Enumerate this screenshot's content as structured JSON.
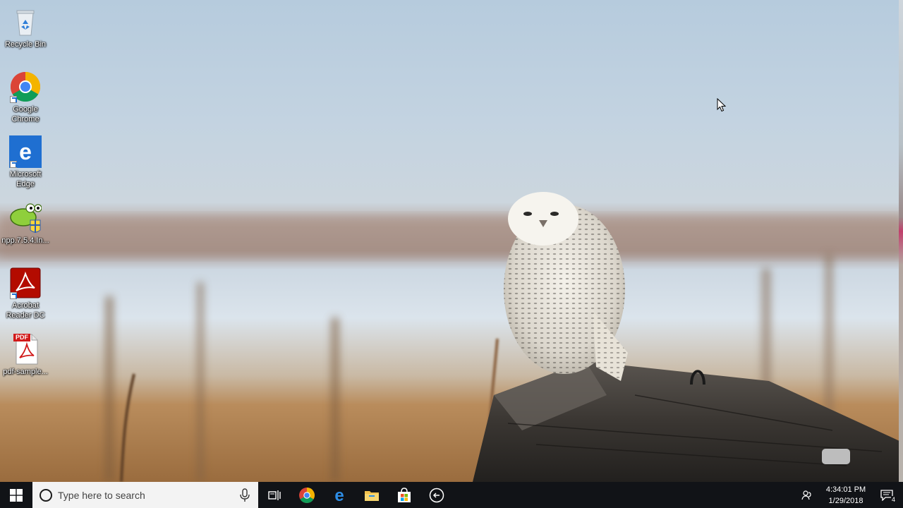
{
  "desktop": {
    "icons": [
      {
        "label": "Recycle Bin",
        "icon": "recycle-bin-icon"
      },
      {
        "label": "Google Chrome",
        "icon": "chrome-icon"
      },
      {
        "label": "Microsoft Edge",
        "icon": "edge-icon"
      },
      {
        "label": "npp.7.5.4.In...",
        "icon": "notepad-plus-plus-installer-icon"
      },
      {
        "label": "Acrobat Reader DC",
        "icon": "acrobat-reader-icon"
      },
      {
        "label": "pdf-sample...",
        "icon": "pdf-file-icon"
      }
    ],
    "pdf_badge": "PDF"
  },
  "taskbar": {
    "search_placeholder": "Type here to search",
    "pinned": [
      {
        "name": "task-view",
        "icon": "task-view-icon"
      },
      {
        "name": "chrome",
        "icon": "chrome-icon"
      },
      {
        "name": "edge",
        "icon": "edge-icon"
      },
      {
        "name": "file-explorer",
        "icon": "folder-icon"
      },
      {
        "name": "store",
        "icon": "store-bag-icon"
      },
      {
        "name": "back",
        "icon": "back-arrow-circle-icon"
      }
    ],
    "clock": {
      "time": "4:34:01 PM",
      "date": "1/29/2018"
    },
    "notification_count": "4"
  },
  "colors": {
    "taskbar_bg": "#111317",
    "search_bg": "#f3f3f3",
    "sky_top": "#b8cde0",
    "accent_blue": "#1f6fd1"
  }
}
